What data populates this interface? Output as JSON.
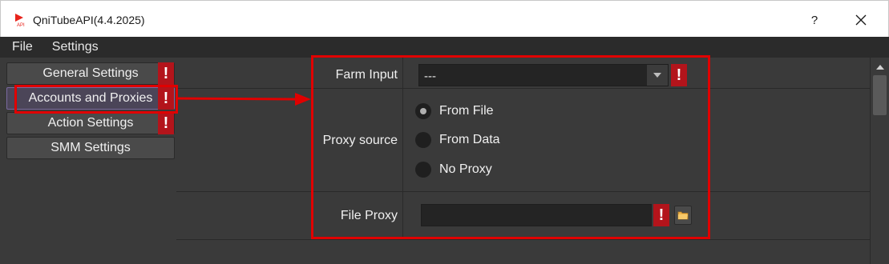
{
  "window": {
    "title": "QniTubeAPI(4.4.2025)",
    "help_label": "?",
    "icon": "app-play-icon"
  },
  "menu": {
    "items": [
      "File",
      "Settings"
    ]
  },
  "nav": {
    "items": [
      {
        "label": "General Settings",
        "warning": true,
        "selected": false
      },
      {
        "label": "Accounts and Proxies",
        "warning": true,
        "selected": true
      },
      {
        "label": "Action Settings",
        "warning": true,
        "selected": false
      },
      {
        "label": "SMM Settings",
        "warning": false,
        "selected": false
      }
    ],
    "warning_glyph": "!"
  },
  "form": {
    "farm_input": {
      "label": "Farm Input",
      "value": "---"
    },
    "proxy_source": {
      "label": "Proxy source",
      "options": [
        "From File",
        "From Data",
        "No Proxy"
      ],
      "selected": "From File"
    },
    "file_proxy": {
      "label": "File Proxy",
      "value": ""
    },
    "warning_glyph": "!"
  },
  "colors": {
    "accent_warning": "#b3141b",
    "annotation": "#e00000",
    "panel_bg": "#3a3a3a",
    "menubar_bg": "#2b2b2b"
  }
}
